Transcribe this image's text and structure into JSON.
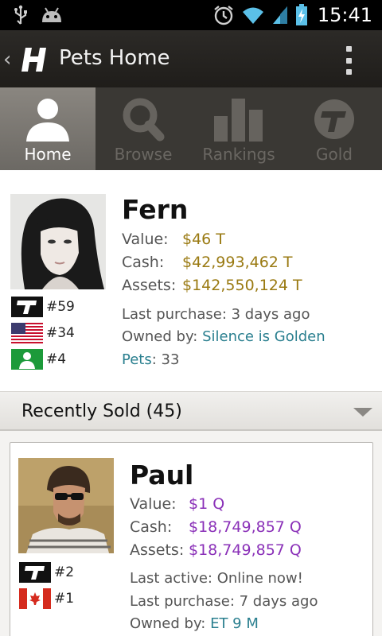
{
  "status_bar": {
    "time": "15:41"
  },
  "action_bar": {
    "title": "Pets Home"
  },
  "tabs": [
    {
      "label": "Home",
      "icon": "person-icon",
      "active": true
    },
    {
      "label": "Browse",
      "icon": "search-icon",
      "active": false
    },
    {
      "label": "Rankings",
      "icon": "bar-chart-icon",
      "active": false
    },
    {
      "label": "Gold",
      "icon": "gold-coin-icon",
      "active": false
    }
  ],
  "profile": {
    "name": "Fern",
    "value_label": "Value:",
    "value": "$46 T",
    "cash_label": "Cash:",
    "cash": "$42,993,462 T",
    "assets_label": "Assets:",
    "assets": "$142,550,124 T",
    "last_purchase": "Last purchase: 3 days ago",
    "owned_by_label": "Owned by: ",
    "owned_by": "Silence is Golden",
    "pets_label": "Pets",
    "pets_count": ": 33",
    "ranks": [
      {
        "icon": "t-logo-icon",
        "rank": "#59"
      },
      {
        "icon": "us-flag-icon",
        "rank": "#34"
      },
      {
        "icon": "friends-icon",
        "rank": "#4"
      }
    ]
  },
  "recently_sold": {
    "title": "Recently Sold (45)",
    "items": [
      {
        "name": "Paul",
        "value_label": "Value:",
        "value": "$1 Q",
        "cash_label": "Cash:",
        "cash": "$18,749,857 Q",
        "assets_label": "Assets:",
        "assets": "$18,749,857 Q",
        "last_active": "Last active: Online now!",
        "last_purchase": "Last purchase: 7 days ago",
        "owned_by_label": "Owned by: ",
        "owned_by": "ET 9 M",
        "ranks": [
          {
            "icon": "t-logo-icon",
            "rank": "#2"
          },
          {
            "icon": "canada-flag-icon",
            "rank": "#1"
          }
        ]
      }
    ]
  },
  "colors": {
    "gold_value": "#9a7a12",
    "purple_value": "#8a30b8",
    "link": "#2a7f8f"
  }
}
